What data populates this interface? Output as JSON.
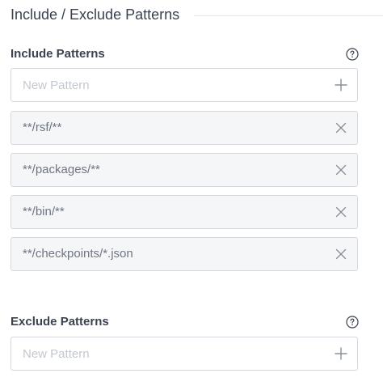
{
  "section": {
    "title": "Include / Exclude Patterns"
  },
  "include": {
    "label": "Include Patterns",
    "help_icon": "question-circle-icon",
    "new_placeholder": "New Pattern",
    "add_icon": "plus-icon",
    "remove_icon": "x-icon",
    "patterns": [
      "**/rsf/**",
      "**/packages/**",
      "**/bin/**",
      "**/checkpoints/*.json"
    ]
  },
  "exclude": {
    "label": "Exclude Patterns",
    "help_icon": "question-circle-icon",
    "new_placeholder": "New Pattern",
    "add_icon": "plus-icon",
    "patterns": []
  },
  "colors": {
    "text": "#3a4250",
    "muted_text": "#6e7683",
    "placeholder": "#c3c7cf",
    "border": "#d4d8de",
    "field_fill": "#f5f6f8",
    "icon": "#8a909a"
  }
}
